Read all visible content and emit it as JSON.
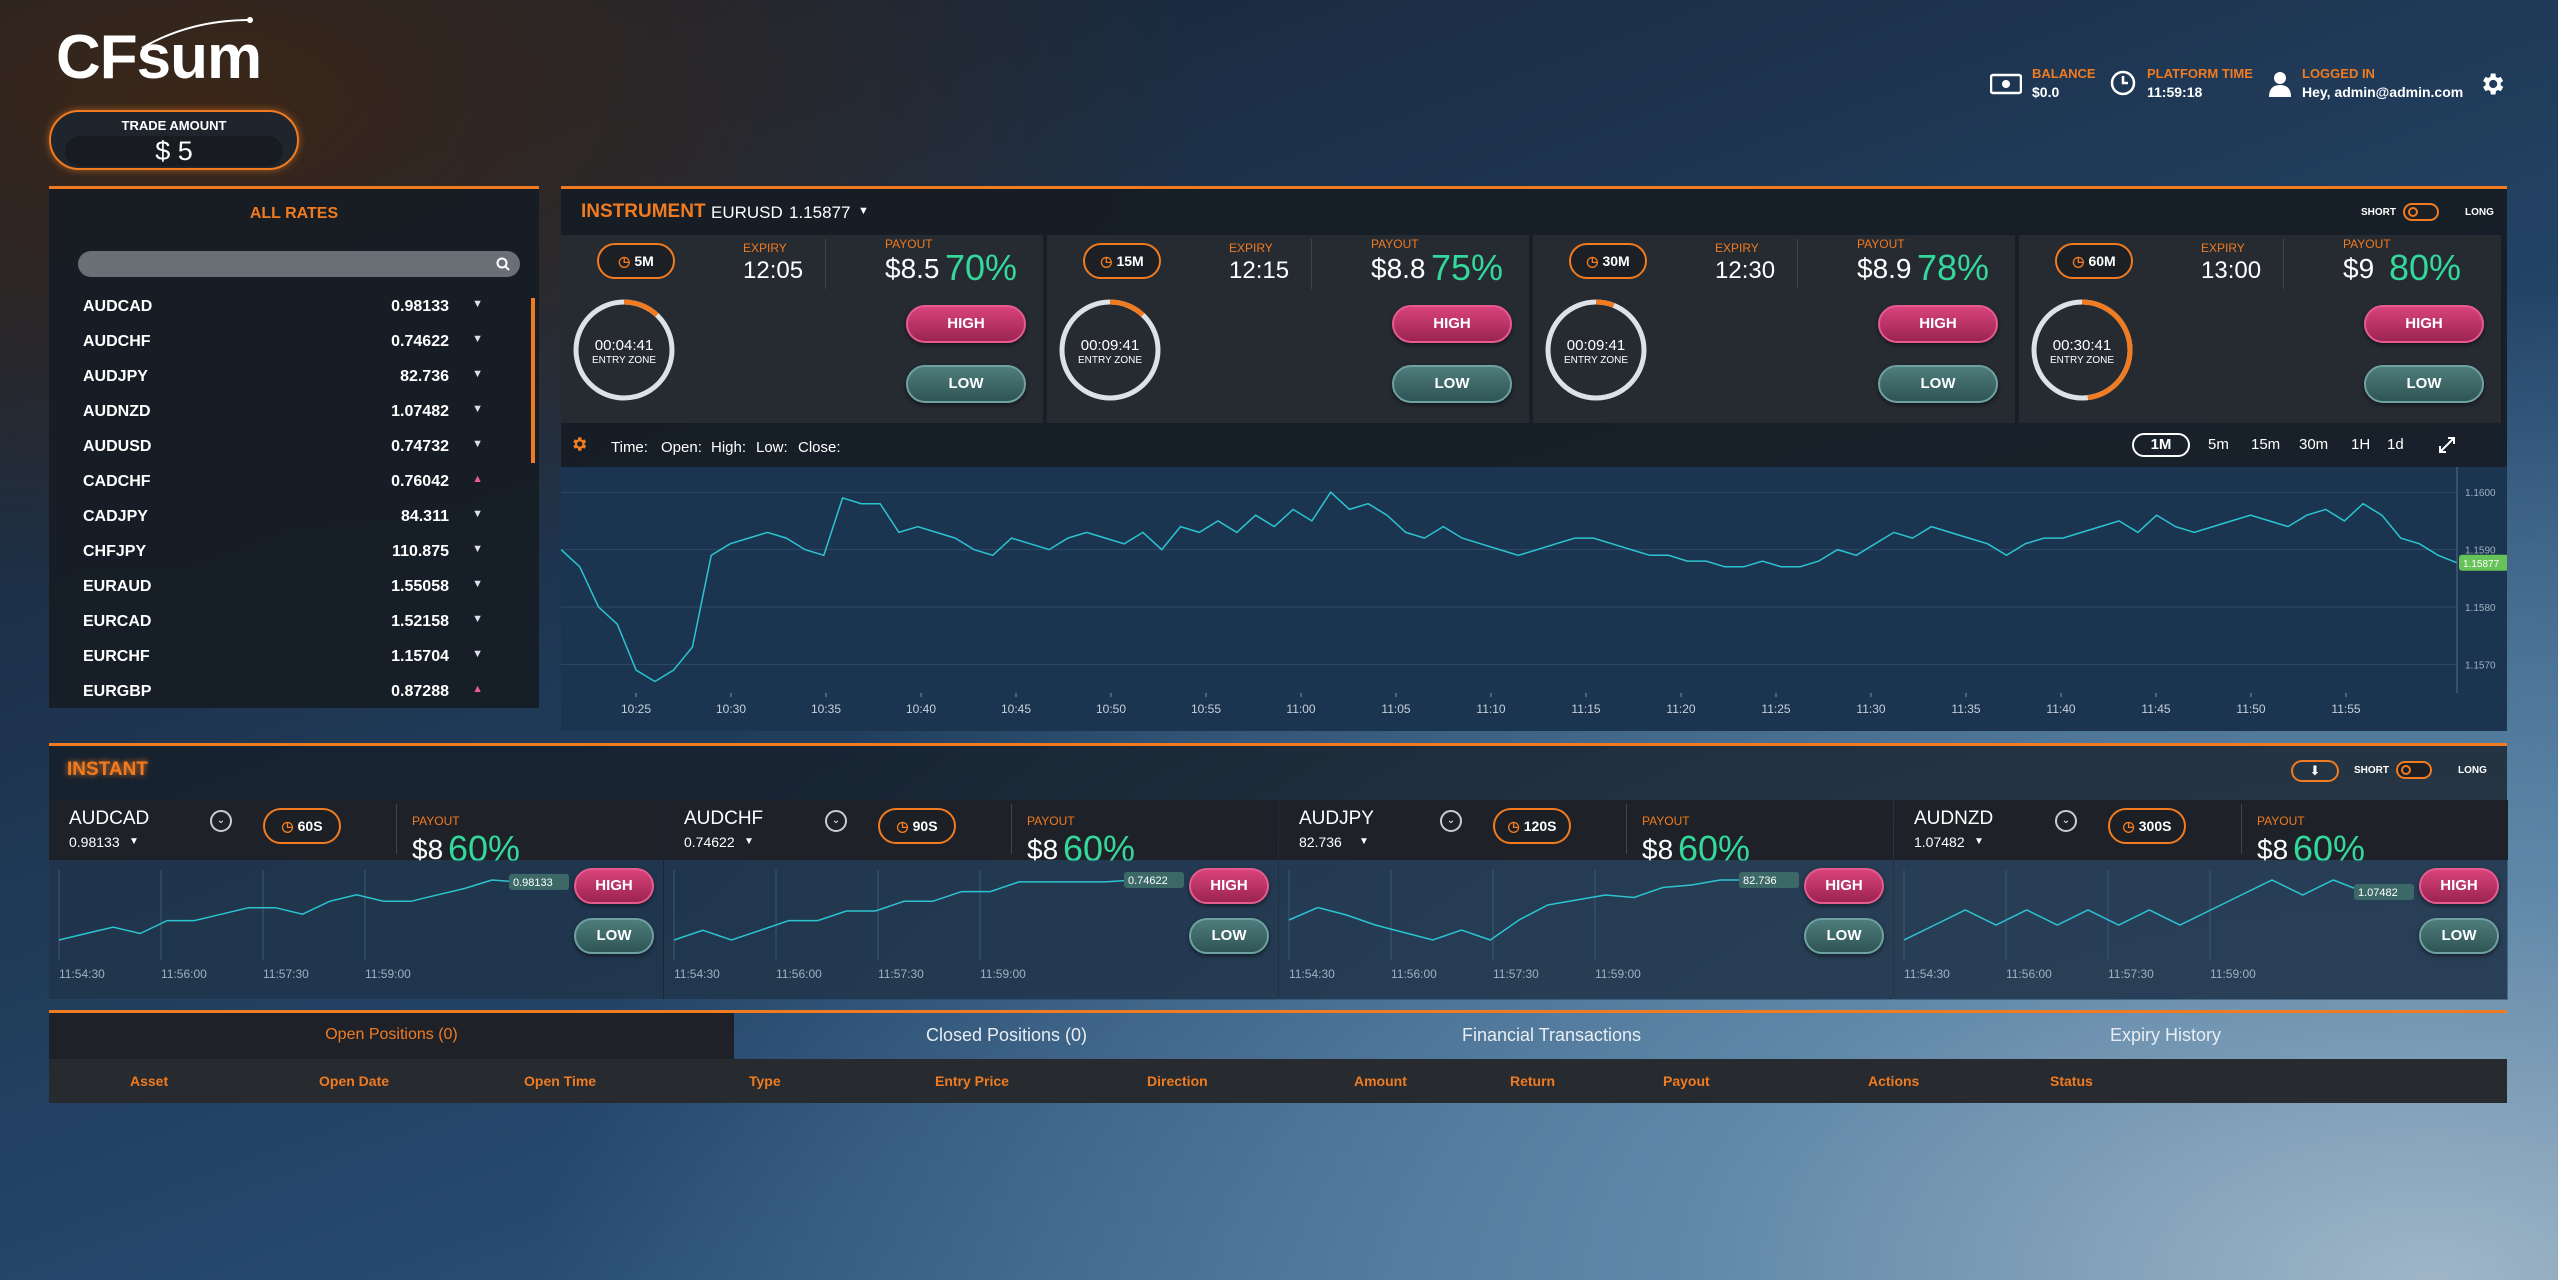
{
  "brand": {
    "logo": "CFsum"
  },
  "trade_amount": {
    "label": "TRADE AMOUNT",
    "value": "$ 5"
  },
  "header": {
    "balance": {
      "label": "BALANCE",
      "value": "$0.0"
    },
    "platform_time": {
      "label": "PLATFORM TIME",
      "value": "11:59:18"
    },
    "logged_in": {
      "label": "LOGGED IN",
      "value": "Hey, admin@admin.com"
    }
  },
  "rates": {
    "title": "ALL RATES",
    "items": [
      {
        "name": "AUDCAD",
        "value": "0.98133",
        "dir": "▼"
      },
      {
        "name": "AUDCHF",
        "value": "0.74622",
        "dir": "▼"
      },
      {
        "name": "AUDJPY",
        "value": "82.736",
        "dir": "▼"
      },
      {
        "name": "AUDNZD",
        "value": "1.07482",
        "dir": "▼"
      },
      {
        "name": "AUDUSD",
        "value": "0.74732",
        "dir": "▼"
      },
      {
        "name": "CADCHF",
        "value": "0.76042",
        "dir": "▲"
      },
      {
        "name": "CADJPY",
        "value": "84.311",
        "dir": "▼"
      },
      {
        "name": "CHFJPY",
        "value": "110.875",
        "dir": "▼"
      },
      {
        "name": "EURAUD",
        "value": "1.55058",
        "dir": "▼"
      },
      {
        "name": "EURCAD",
        "value": "1.52158",
        "dir": "▼"
      },
      {
        "name": "EURCHF",
        "value": "1.15704",
        "dir": "▼"
      },
      {
        "name": "EURGBP",
        "value": "0.87288",
        "dir": "▲"
      }
    ]
  },
  "instrument": {
    "title": "INSTRUMENT",
    "pair": "EURUSD",
    "price": "1.15877",
    "short": "SHORT",
    "long": "LONG",
    "cards": [
      {
        "chip": "5M",
        "expiry_label": "EXPIRY",
        "expiry": "12:05",
        "payout_label": "PAYOUT",
        "payout_amount": "$8.5",
        "payout_pct": "70%",
        "timer": "00:04:41",
        "zone": "ENTRY ZONE",
        "high": "HIGH",
        "low": "LOW",
        "progress": 0.12
      },
      {
        "chip": "15M",
        "expiry_label": "EXPIRY",
        "expiry": "12:15",
        "payout_label": "PAYOUT",
        "payout_amount": "$8.8",
        "payout_pct": "75%",
        "timer": "00:09:41",
        "zone": "ENTRY ZONE",
        "high": "HIGH",
        "low": "LOW",
        "progress": 0.12
      },
      {
        "chip": "30M",
        "expiry_label": "EXPIRY",
        "expiry": "12:30",
        "payout_label": "PAYOUT",
        "payout_amount": "$8.9",
        "payout_pct": "78%",
        "timer": "00:09:41",
        "zone": "ENTRY ZONE",
        "high": "HIGH",
        "low": "LOW",
        "progress": 0.06
      },
      {
        "chip": "60M",
        "expiry_label": "EXPIRY",
        "expiry": "13:00",
        "payout_label": "PAYOUT",
        "payout_amount": "$9",
        "payout_pct": "80%",
        "timer": "00:30:41",
        "zone": "ENTRY ZONE",
        "high": "HIGH",
        "low": "LOW",
        "progress": 0.48
      }
    ],
    "chart_toolbar": {
      "time": "Time:",
      "open": "Open:",
      "high": "High:",
      "low": "Low:",
      "close": "Close:",
      "ranges": [
        "1M",
        "5m",
        "15m",
        "30m",
        "1H",
        "1d"
      ],
      "active_range": "1M"
    }
  },
  "chart_data": {
    "type": "line",
    "x_ticks": [
      "10:25",
      "10:30",
      "10:35",
      "10:40",
      "10:45",
      "10:50",
      "10:55",
      "11:00",
      "11:05",
      "11:10",
      "11:15",
      "11:20",
      "11:25",
      "11:30",
      "11:35",
      "11:40",
      "11:45",
      "11:50",
      "11:55"
    ],
    "y_ticks": [
      "1.1600",
      "1.1590",
      "1.1580",
      "1.1570"
    ],
    "ylim": [
      1.1565,
      1.1603
    ],
    "current_price": "1.15877",
    "values": [
      1.159,
      1.1587,
      1.158,
      1.1577,
      1.1569,
      1.1567,
      1.1569,
      1.1573,
      1.1589,
      1.1591,
      1.1592,
      1.1593,
      1.1592,
      1.159,
      1.1589,
      1.1599,
      1.1598,
      1.1598,
      1.1593,
      1.1594,
      1.1593,
      1.1592,
      1.159,
      1.1589,
      1.1592,
      1.1591,
      1.159,
      1.1592,
      1.1593,
      1.1592,
      1.1591,
      1.1593,
      1.159,
      1.1594,
      1.1593,
      1.1595,
      1.1593,
      1.1596,
      1.1594,
      1.1597,
      1.1595,
      1.16,
      1.1597,
      1.1598,
      1.1596,
      1.1593,
      1.1592,
      1.1594,
      1.1592,
      1.1591,
      1.159,
      1.1589,
      1.159,
      1.1591,
      1.1592,
      1.1592,
      1.1591,
      1.159,
      1.1589,
      1.1589,
      1.1588,
      1.1588,
      1.1587,
      1.1587,
      1.1588,
      1.1587,
      1.1587,
      1.1588,
      1.159,
      1.1589,
      1.1591,
      1.1593,
      1.1592,
      1.1594,
      1.1593,
      1.1592,
      1.1591,
      1.1589,
      1.1591,
      1.1592,
      1.1592,
      1.1593,
      1.1594,
      1.1595,
      1.1593,
      1.1596,
      1.1594,
      1.1593,
      1.1594,
      1.1595,
      1.1596,
      1.1595,
      1.1594,
      1.1596,
      1.1597,
      1.1595,
      1.1598,
      1.1596,
      1.1592,
      1.1591,
      1.1589,
      1.15877
    ]
  },
  "instant": {
    "title": "INSTANT",
    "short": "SHORT",
    "long": "LONG",
    "cards": [
      {
        "pair": "AUDCAD",
        "price": "0.98133",
        "chip": "60S",
        "payout_label": "PAYOUT",
        "payout_amount": "$8",
        "payout_pct": "60%",
        "tag": "0.98133",
        "high": "HIGH",
        "low": "LOW",
        "times": [
          "11:54:30",
          "11:56:00",
          "11:57:30",
          "11:59:00"
        ],
        "values": [
          0.9804,
          0.9805,
          0.9806,
          0.9805,
          0.9807,
          0.9807,
          0.9808,
          0.9809,
          0.9809,
          0.9808,
          0.981,
          0.9811,
          0.981,
          0.981,
          0.9811,
          0.9812,
          0.98133,
          0.9813
        ]
      },
      {
        "pair": "AUDCHF",
        "price": "0.74622",
        "chip": "90S",
        "payout_label": "PAYOUT",
        "payout_amount": "$8",
        "payout_pct": "60%",
        "tag": "0.74622",
        "high": "HIGH",
        "low": "LOW",
        "times": [
          "11:54:30",
          "11:56:00",
          "11:57:30",
          "11:59:00"
        ],
        "values": [
          0.7456,
          0.7457,
          0.7456,
          0.7457,
          0.7458,
          0.7458,
          0.7459,
          0.7459,
          0.746,
          0.746,
          0.7461,
          0.7461,
          0.7462,
          0.7462,
          0.7462,
          0.7462,
          0.74622
        ]
      },
      {
        "pair": "AUDJPY",
        "price": "82.736",
        "chip": "120S",
        "payout_label": "PAYOUT",
        "payout_amount": "$8",
        "payout_pct": "60%",
        "tag": "82.736",
        "high": "HIGH",
        "low": "LOW",
        "times": [
          "11:54:30",
          "11:56:00",
          "11:57:30",
          "11:59:00"
        ],
        "values": [
          82.72,
          82.725,
          82.722,
          82.718,
          82.715,
          82.712,
          82.716,
          82.712,
          82.72,
          82.726,
          82.728,
          82.73,
          82.729,
          82.733,
          82.734,
          82.736,
          82.736
        ]
      },
      {
        "pair": "AUDNZD",
        "price": "1.07482",
        "chip": "300S",
        "payout_label": "PAYOUT",
        "payout_amount": "$8",
        "payout_pct": "60%",
        "tag": "1.07482",
        "high": "HIGH",
        "low": "LOW",
        "times": [
          "11:54:30",
          "11:56:00",
          "11:57:30",
          "11:59:00"
        ],
        "values": [
          1.0745,
          1.0746,
          1.0747,
          1.0746,
          1.0747,
          1.0746,
          1.0747,
          1.0746,
          1.0747,
          1.0746,
          1.0747,
          1.0748,
          1.0749,
          1.0748,
          1.0749,
          1.07482
        ]
      }
    ]
  },
  "positions": {
    "tabs": [
      "Open Positions (0)",
      "Closed Positions (0)",
      "Financial Transactions",
      "Expiry History"
    ],
    "active_tab": "Open Positions (0)",
    "columns": [
      "Asset",
      "Open Date",
      "Open Time",
      "Type",
      "Entry Price",
      "Direction",
      "Amount",
      "Return",
      "Payout",
      "Actions",
      "Status"
    ]
  },
  "colors": {
    "accent": "#f07b20",
    "green": "#33d89a",
    "high": "#c73468",
    "low": "#3d6868",
    "line": "#2bc4d0"
  },
  "icons": {
    "balance": "money-icon",
    "time": "clock-icon",
    "user": "user-icon",
    "settings": "gear-icon",
    "search": "search-icon"
  }
}
